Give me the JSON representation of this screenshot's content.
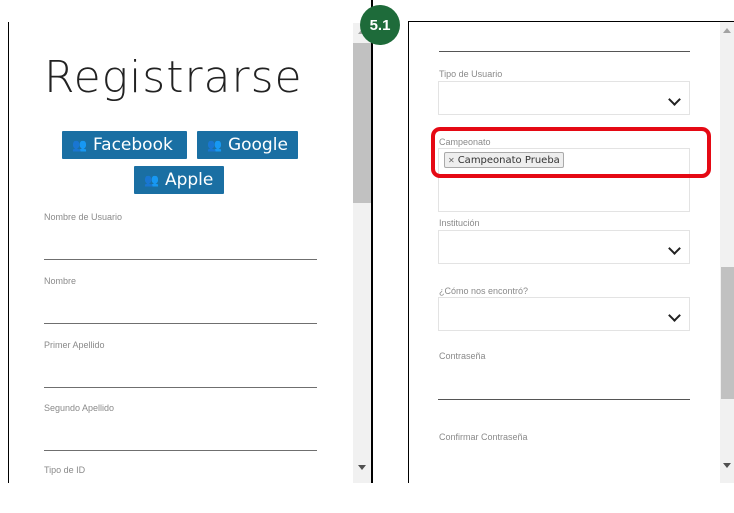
{
  "step_badge": "5.1",
  "left_form": {
    "title": "Registrarse",
    "social": {
      "facebook": "Facebook",
      "google": "Google",
      "apple": "Apple",
      "icon": "user-plus-icon"
    },
    "fields": {
      "username": "Nombre de Usuario",
      "name": "Nombre",
      "first_surname": "Primer Apellido",
      "second_surname": "Segundo Apellido",
      "id_type": "Tipo de ID"
    }
  },
  "right_form": {
    "user_type": {
      "label": "Tipo de Usuario",
      "value": ""
    },
    "championship": {
      "label": "Campeonato",
      "selected": [
        "Campeonato Prueba"
      ],
      "remove_icon": "close-icon"
    },
    "institution": {
      "label": "Institución",
      "value": ""
    },
    "how_found": {
      "label": "¿Cómo nos encontró?",
      "value": ""
    },
    "password": {
      "label": "Contraseña"
    },
    "confirm_password": {
      "label": "Confirmar Contraseña"
    }
  },
  "annotation": {
    "highlight_color": "#e50914",
    "badge_color": "#1e6b3a",
    "button_color": "#1a6fa3"
  }
}
